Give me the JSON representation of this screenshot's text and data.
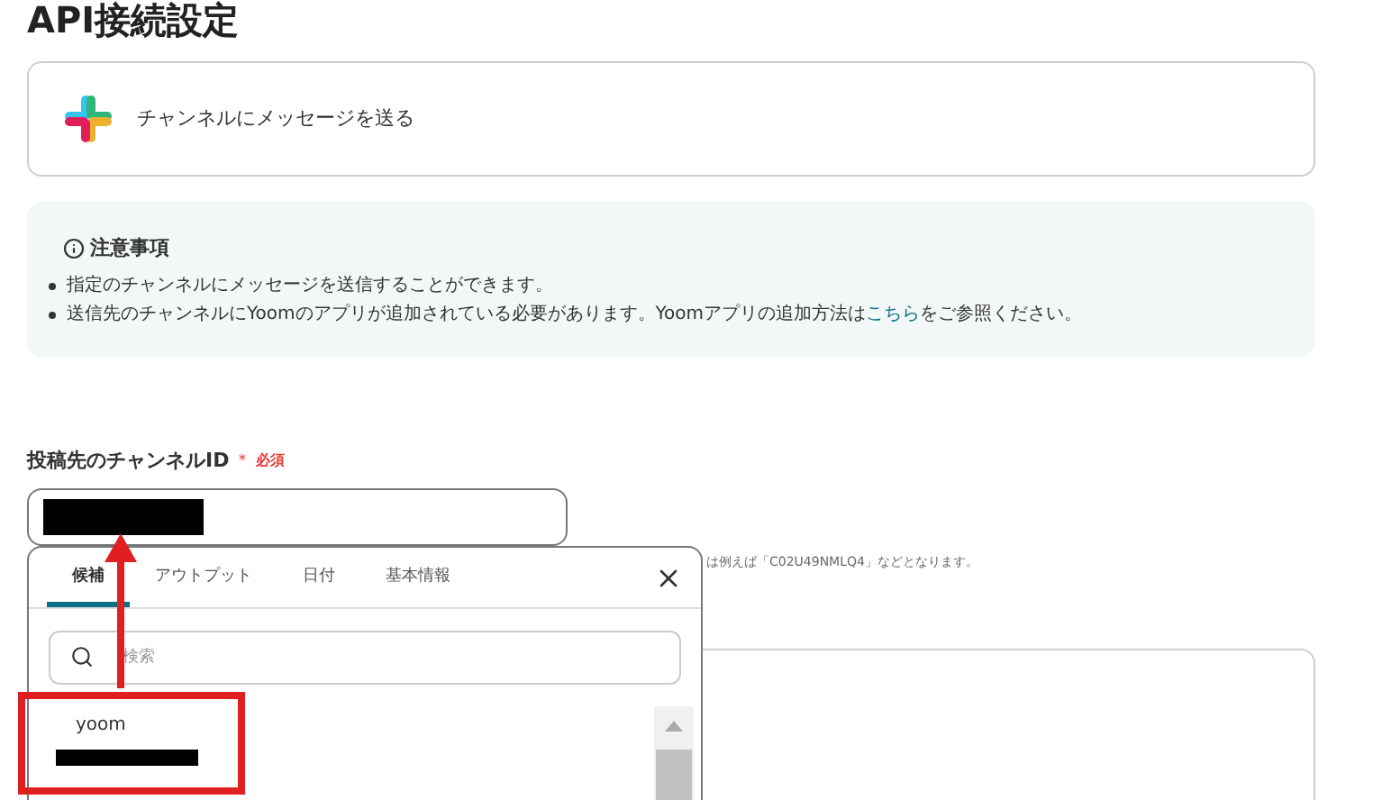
{
  "title": "API接続設定",
  "action": {
    "label": "チャンネルにメッセージを送る"
  },
  "notice": {
    "heading": "注意事項",
    "items": [
      {
        "text": "指定のチャンネルにメッセージを送信することができます。"
      },
      {
        "text": "送信先のチャンネルにYoomのアプリが追加されている必要があります。Yoomアプリの追加方法は",
        "link": "こちら",
        "after": "をご参照ください。"
      }
    ]
  },
  "field": {
    "label": "投稿先のチャンネルID",
    "required_mark": "＊",
    "required": "必須",
    "hint": "は例えば「C02U49NMLQ4」などとなります。"
  },
  "popup": {
    "tabs": [
      {
        "label": "候補",
        "selected": true
      },
      {
        "label": "アウトプット",
        "selected": false
      },
      {
        "label": "日付",
        "selected": false
      },
      {
        "label": "基本情報",
        "selected": false
      }
    ],
    "search": {
      "placeholder": "検索"
    },
    "items": [
      {
        "label": "yoom"
      }
    ]
  }
}
